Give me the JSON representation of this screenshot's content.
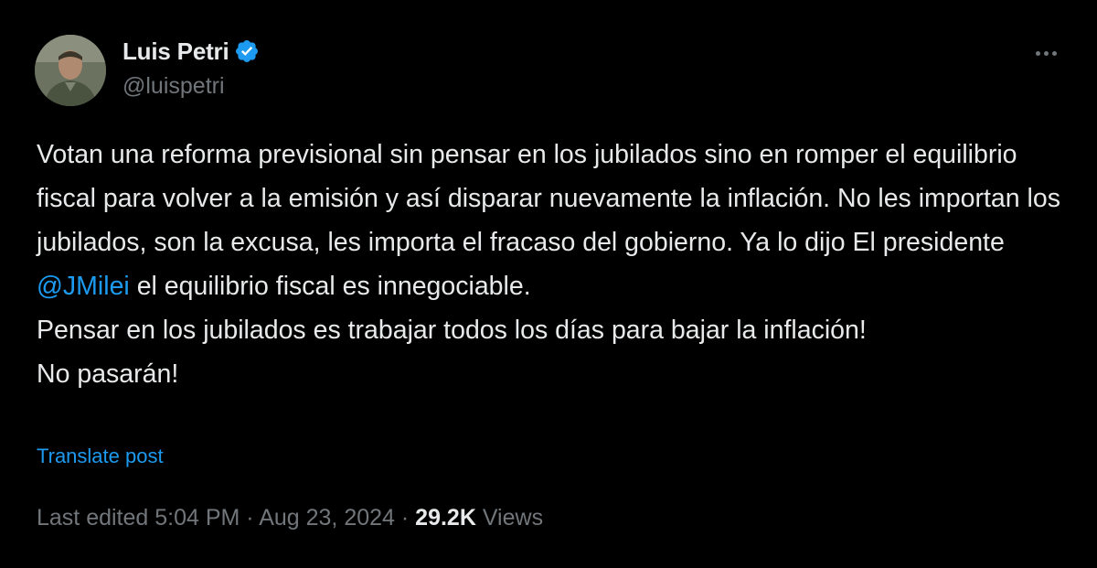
{
  "author": {
    "display_name": "Luis Petri",
    "handle": "@luispetri",
    "verified": true,
    "verified_color": "#1d9bf0"
  },
  "post": {
    "text_before_mention": "Votan una reforma previsional sin pensar en los jubilados sino en romper el equilibrio fiscal para volver a la emisión y así disparar nuevamente la inflación. No les importan los jubilados, son la excusa, les importa el fracaso del gobierno. Ya lo dijo El presidente ",
    "mention": "@JMilei",
    "text_after_mention": " el equilibrio fiscal es innegociable.",
    "line_2": "Pensar en los jubilados es trabajar todos los días para bajar la inflación!",
    "line_3": "No pasarán!",
    "translate_label": "Translate post"
  },
  "meta": {
    "edited_label": "Last edited 5:04 PM · Aug 23, 2024 · ",
    "views_count": "29.2K",
    "views_label": " Views"
  },
  "colors": {
    "background": "#000000",
    "text": "#e7e9ea",
    "secondary": "#71767b",
    "accent": "#1d9bf0"
  },
  "icons": {
    "more": "more-horizontal-icon",
    "verified": "verified-badge-icon"
  }
}
